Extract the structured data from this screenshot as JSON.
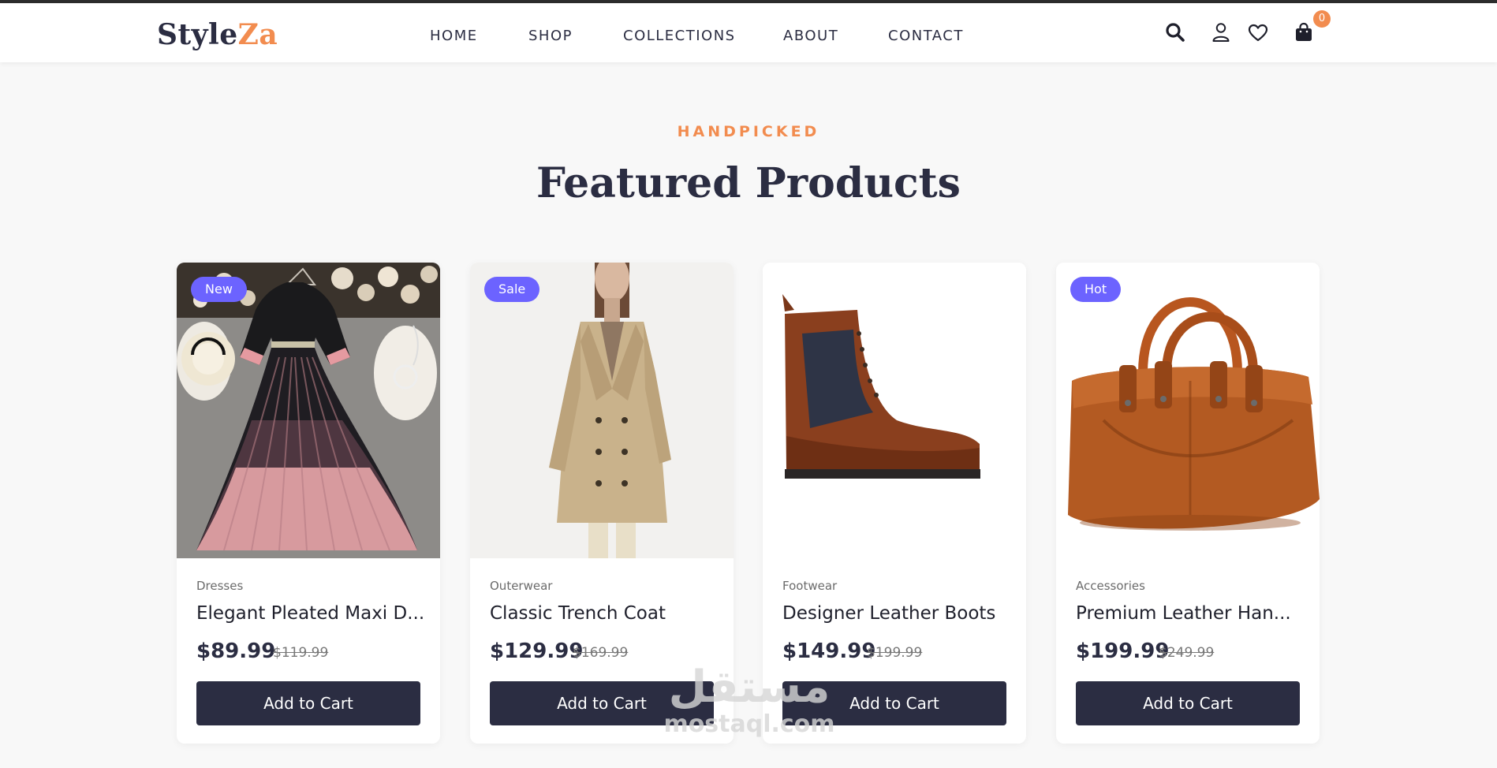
{
  "header": {
    "logo": {
      "part1": "Style",
      "part2": "Za"
    },
    "nav": [
      "HOME",
      "SHOP",
      "COLLECTIONS",
      "ABOUT",
      "CONTACT"
    ],
    "icons": [
      "search-icon",
      "user-icon",
      "heart-icon",
      "shopping-bag-icon"
    ],
    "cart_count": "0"
  },
  "section": {
    "eyebrow": "HANDPICKED",
    "title": "Featured Products"
  },
  "products": [
    {
      "badge": "New",
      "category": "Dresses",
      "name": "Elegant Pleated Maxi D...",
      "price": "$89.99",
      "old_price": "$119.99",
      "button": "Add to Cart"
    },
    {
      "badge": "Sale",
      "category": "Outerwear",
      "name": "Classic Trench Coat",
      "price": "$129.99",
      "old_price": "$169.99",
      "button": "Add to Cart"
    },
    {
      "badge": "",
      "category": "Footwear",
      "name": "Designer Leather Boots",
      "price": "$149.99",
      "old_price": "$199.99",
      "button": "Add to Cart"
    },
    {
      "badge": "Hot",
      "category": "Accessories",
      "name": "Premium Leather Han...",
      "price": "$199.99",
      "old_price": "$249.99",
      "button": "Add to Cart"
    }
  ],
  "watermark": {
    "arabic": "مستقل",
    "latin": "mostaql.com"
  },
  "colors": {
    "accent": "#f28c4f",
    "primary": "#2b2d42",
    "badge": "#6c63ff",
    "background": "#f8f8f8"
  }
}
